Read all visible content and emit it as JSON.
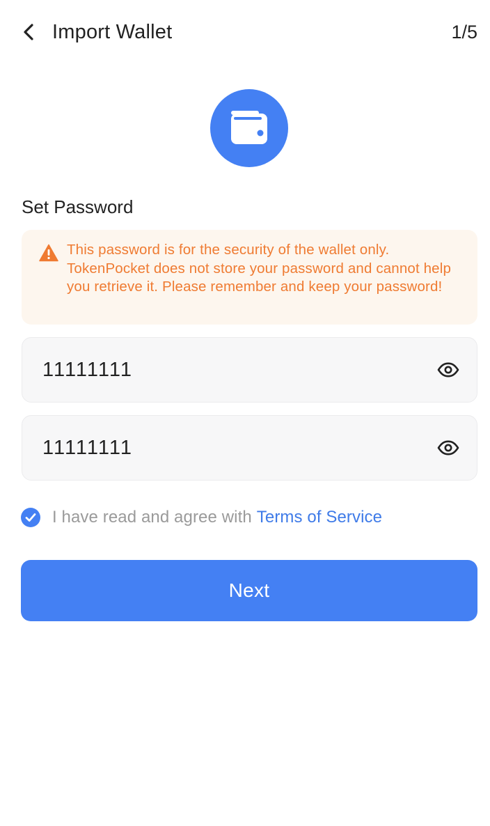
{
  "header": {
    "title": "Import Wallet",
    "step": "1/5"
  },
  "section_label": "Set Password",
  "warning": {
    "text": "This password is for the security of the wallet only. TokenPocket does not store your password and cannot help you retrieve it. Please remember and keep your password!"
  },
  "password_field": {
    "value": "11111111"
  },
  "confirm_field": {
    "value": "11111111"
  },
  "agreement": {
    "checked": true,
    "text": "I have read and agree with",
    "link": "Terms of Service"
  },
  "next_button": {
    "label": "Next"
  },
  "colors": {
    "primary": "#4480f3",
    "warning_text": "#ef7b32",
    "warning_bg": "#fdf6ee",
    "link": "#3f7be8"
  },
  "icons": {
    "back": "chevron-left-icon",
    "hero": "wallet-icon",
    "warning": "warning-triangle-icon",
    "eye": "eye-icon",
    "check": "check-circle-icon"
  }
}
